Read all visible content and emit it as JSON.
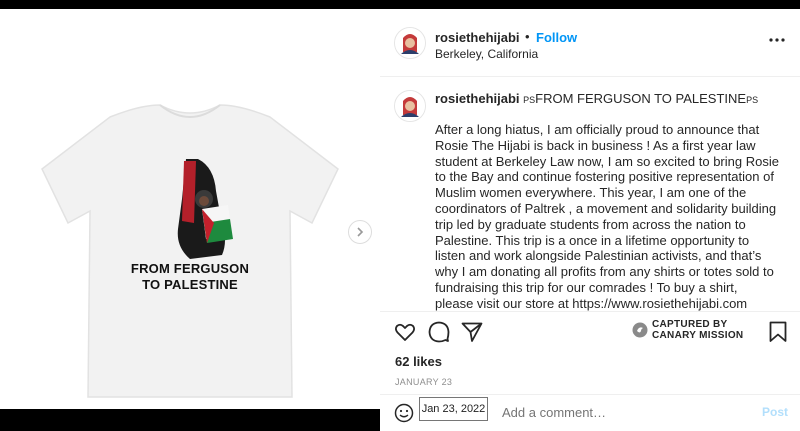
{
  "post": {
    "username": "rosiethehijabi",
    "separator": "•",
    "follow_label": "Follow",
    "location": "Berkeley, California",
    "caption_title_prefix": "PS",
    "caption_title": "FROM FERGUSON TO PALESTINE",
    "caption_title_suffix": "PS",
    "caption_body": "After a long hiatus, I am officially proud to announce that Rosie The Hijabi is back in business ! As a first year law student at Berkeley Law now, I am so excited to bring Rosie to the Bay and continue fostering positive representation of Muslim women everywhere. This year, I am one of the coordinators of Paltrek , a movement and solidarity building trip led by graduate students from across the nation to Palestine. This trip is a once in a lifetime opportunity to listen and work alongside Palestinian activists, and that’s why I am donating all profits from any shirts or totes sold to fundraising this trip for our comrades ! To buy a shirt, please visit our store at https://www.rosiethehijabi.com",
    "likes": "62 likes",
    "date": "JANUARY 23",
    "comment_placeholder": "Add a comment…",
    "post_label": "Post"
  },
  "shirt": {
    "line1": "FROM FERGUSON",
    "line2": "TO PALESTINE"
  },
  "watermark": {
    "line1": "CAPTURED BY",
    "line2": "CANARY MISSION"
  },
  "tooltip": {
    "text": "Jan 23, 2022"
  },
  "icons": {
    "like": "heart-icon",
    "comment": "comment-icon",
    "share": "paper-plane-icon",
    "save": "bookmark-icon",
    "emoji": "smiley-icon",
    "more": "ellipsis-icon",
    "next": "chevron-right-icon"
  },
  "colors": {
    "accent": "#0095f6",
    "post_disabled": "#b2dffc",
    "text": "#262626",
    "muted": "#8e8e8e"
  }
}
